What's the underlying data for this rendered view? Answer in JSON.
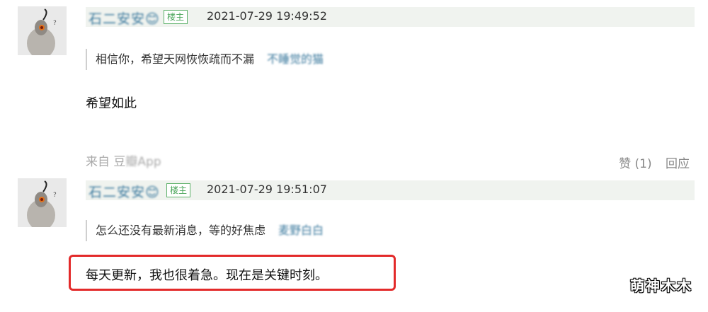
{
  "comments": [
    {
      "username": "石二安安😊",
      "badge": "楼主",
      "timestamp": "2021-07-29 19:49:52",
      "quote_text": "相信你，希望天网恢恢疏而不漏",
      "quote_author": "不睡觉的猫",
      "body": "希望如此",
      "source_prefix": "来自 豆",
      "source_suffix": "瓣App",
      "like_label": "赞 (1)",
      "reply_label": "回应"
    },
    {
      "username": "石二安安😊",
      "badge": "楼主",
      "timestamp": "2021-07-29 19:51:07",
      "quote_text": "怎么还没有最新消息，等的好焦虑",
      "quote_author": "麦野白白",
      "body": "每天更新，我也很着急。现在是关键时刻。"
    }
  ],
  "watermark": "萌神木木",
  "colors": {
    "meta_bar_bg": "#f0f3ef",
    "badge_green": "#4aa55a",
    "link_blue": "#3c7a9e",
    "highlight_red": "#e32a2a"
  },
  "icons": {
    "avatar": "bird-avatar-icon"
  }
}
